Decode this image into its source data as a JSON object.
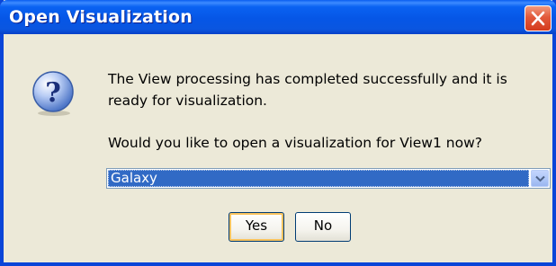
{
  "window": {
    "title": "Open Visualization"
  },
  "icons": {
    "dialog": "question-icon",
    "close": "close-icon",
    "dropdown": "chevron-down-icon"
  },
  "colors": {
    "titlebar": "#0656e6",
    "dialog_bg": "#ece9d8",
    "selection": "#316ac5",
    "close_button": "#e2593b",
    "default_button_focus": "#f9c35e"
  },
  "dialog": {
    "message": "The View processing has completed successfully and it is ready for visualization.",
    "prompt": "Would you like to open a visualization for View1 now?",
    "select": {
      "value": "Galaxy"
    },
    "buttons": {
      "yes": "Yes",
      "no": "No"
    }
  }
}
